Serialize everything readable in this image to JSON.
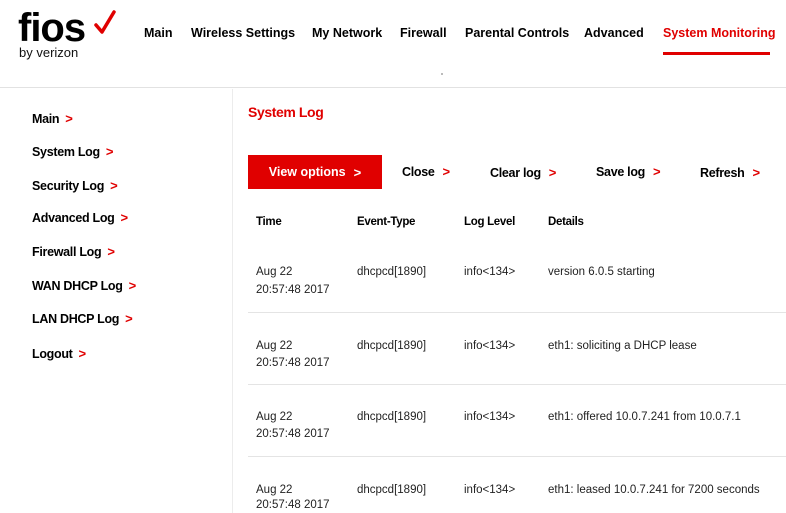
{
  "brand": {
    "name": "fios",
    "tagline": "by verizon",
    "accent_color": "#e00000"
  },
  "topnav": [
    {
      "label": "Main",
      "active": false
    },
    {
      "label": "Wireless Settings",
      "active": false
    },
    {
      "label": "My Network",
      "active": false
    },
    {
      "label": "Firewall",
      "active": false
    },
    {
      "label": "Parental Controls",
      "active": false
    },
    {
      "label": "Advanced",
      "active": false
    },
    {
      "label": "System Monitoring",
      "active": true
    }
  ],
  "sidebar": {
    "items": [
      {
        "label": "Main",
        "icon": "chevron-right-icon"
      },
      {
        "label": "System Log",
        "icon": "chevron-right-icon"
      },
      {
        "label": "Security Log",
        "icon": "chevron-right-icon"
      },
      {
        "label": "Advanced Log",
        "icon": "chevron-right-icon"
      },
      {
        "label": "Firewall Log",
        "icon": "chevron-right-icon"
      },
      {
        "label": "WAN DHCP Log",
        "icon": "chevron-right-icon"
      },
      {
        "label": "LAN DHCP Log",
        "icon": "chevron-right-icon"
      },
      {
        "label": "Logout",
        "icon": "chevron-right-icon"
      }
    ]
  },
  "main": {
    "title": "System Log",
    "actions": {
      "view_options": "View options",
      "close": "Close",
      "clear_log": "Clear log",
      "save_log": "Save log",
      "refresh": "Refresh"
    },
    "chevron": ">",
    "columns": [
      "Time",
      "Event-Type",
      "Log Level",
      "Details"
    ],
    "rows": [
      {
        "date": "Aug 22",
        "time": "20:57:48 2017",
        "event_type": "dhcpcd[1890]",
        "log_level": "info<134>",
        "details": "version 6.0.5 starting"
      },
      {
        "date": "Aug 22",
        "time": "20:57:48 2017",
        "event_type": "dhcpcd[1890]",
        "log_level": "info<134>",
        "details": "eth1: soliciting a DHCP lease"
      },
      {
        "date": "Aug 22",
        "time": "20:57:48 2017",
        "event_type": "dhcpcd[1890]",
        "log_level": "info<134>",
        "details": "eth1: offered 10.0.7.241 from 10.0.7.1"
      },
      {
        "date": "Aug 22",
        "time": "20:57:48 2017",
        "event_type": "dhcpcd[1890]",
        "log_level": "info<134>",
        "details": "eth1: leased 10.0.7.241 for 7200 seconds"
      }
    ]
  }
}
